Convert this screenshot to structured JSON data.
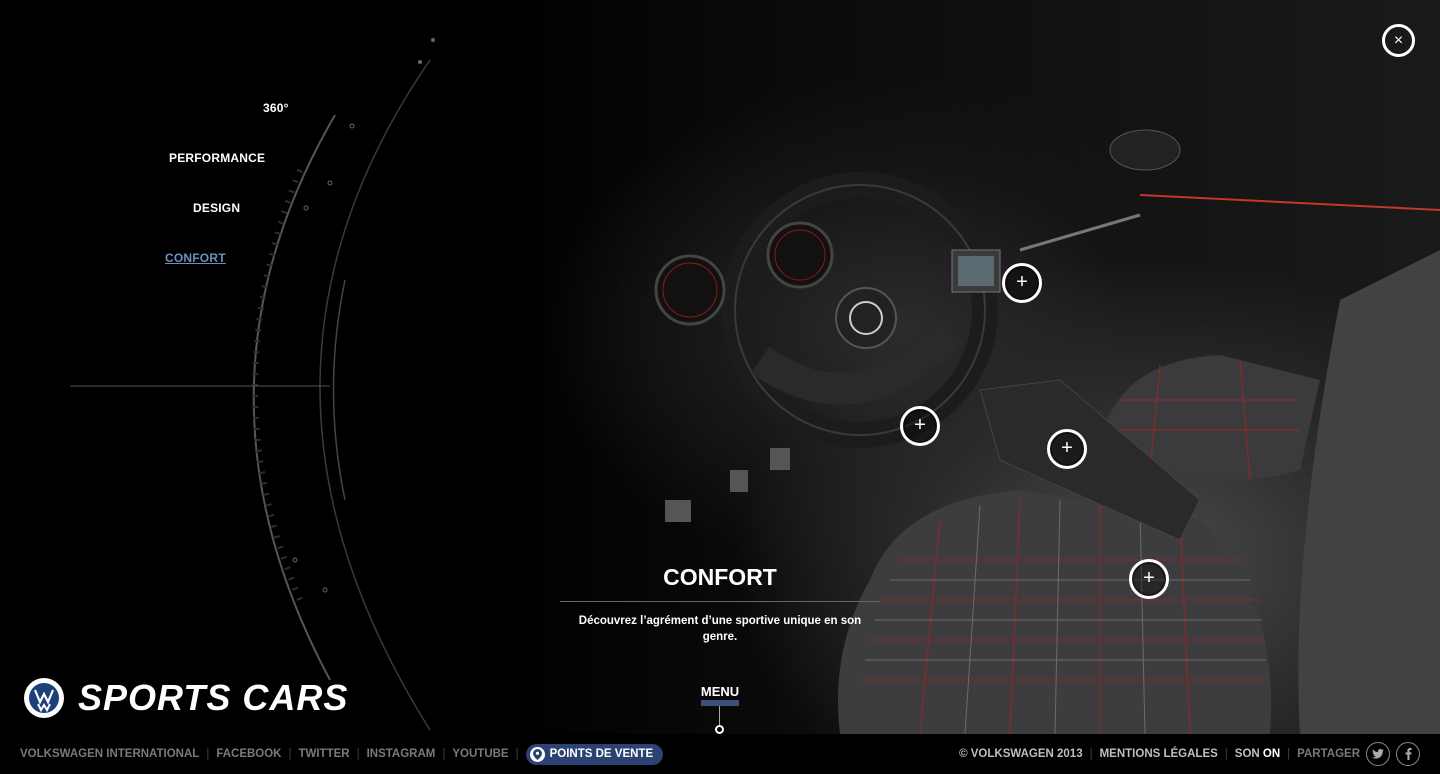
{
  "nav": {
    "items": [
      {
        "label": "360°"
      },
      {
        "label": "PERFORMANCE"
      },
      {
        "label": "DESIGN"
      },
      {
        "label": "CONFORT",
        "active": true
      }
    ]
  },
  "close": {
    "icon": "close-icon",
    "glyph": "×"
  },
  "hotspots": [
    {
      "icon": "plus-icon",
      "glyph": "+"
    },
    {
      "icon": "plus-icon",
      "glyph": "+"
    },
    {
      "icon": "plus-icon",
      "glyph": "+"
    },
    {
      "icon": "plus-icon",
      "glyph": "+"
    }
  ],
  "section": {
    "title": "CONFORT",
    "description": "Découvrez l’agrément d’une sportive unique en son genre."
  },
  "menu": {
    "label": "MENU"
  },
  "brand": {
    "title": "SPORTS CARS",
    "logo": "vw-logo"
  },
  "footer": {
    "links": [
      "VOLKSWAGEN INTERNATIONAL",
      "FACEBOOK",
      "TWITTER",
      "INSTAGRAM",
      "YOUTUBE"
    ],
    "points_de_vente": "POINTS DE VENTE",
    "copyright": "© VOLKSWAGEN 2013",
    "mentions": "MENTIONS LÉGALES",
    "son_label": "SON",
    "son_state": "ON",
    "partager": "PARTAGER",
    "social_icons": [
      "twitter-icon",
      "facebook-icon"
    ]
  },
  "colors": {
    "accent": "#2c4272",
    "active_nav": "#6c8fbe"
  }
}
